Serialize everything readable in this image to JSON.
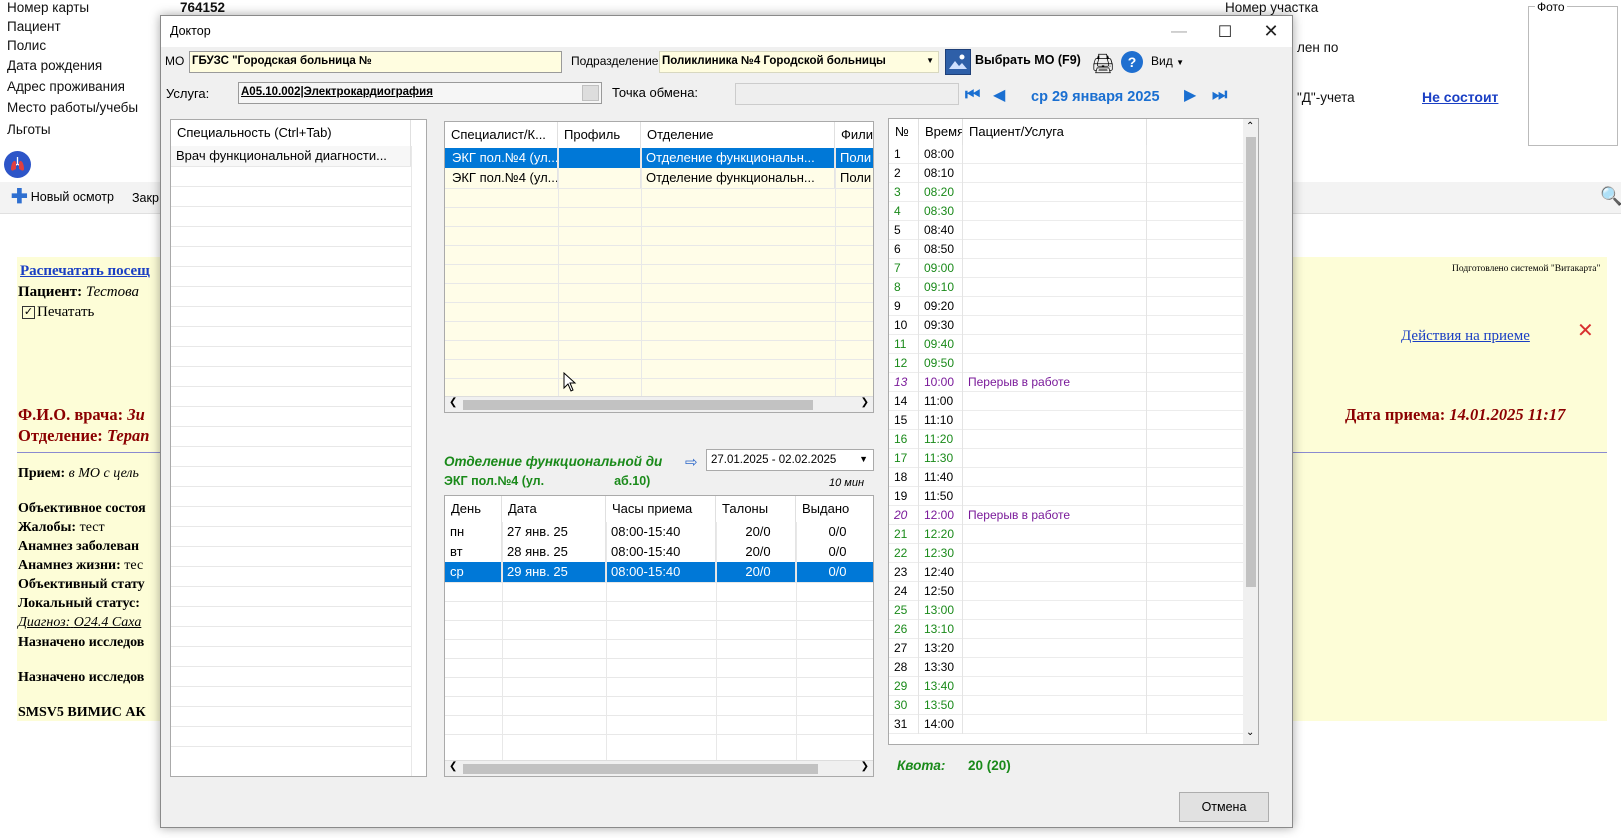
{
  "background": {
    "left_labels": [
      "Номер карты",
      "Пациент",
      "Полис",
      "Дата рождения",
      "Адрес проживания",
      "Место работы/учебы",
      "Льготы"
    ],
    "card_number": "764152",
    "district_label": "Номер участка",
    "photo_label": "Фото",
    "reg_label_fragment": "лен по",
    "d_account_label": "\"Д\"-учета",
    "not_registered_link": "Не состоит",
    "toolbar": {
      "new_exam": "Новый осмотр",
      "close_fragment": "Закр"
    },
    "doc": {
      "print_visit_link": "Распечатать посещ",
      "patient_label": "Пациент:",
      "patient_value": "Тестова",
      "print_checkbox_label": "Печатать",
      "prepared_by": "Подготовлено системой \"Витакарта\"",
      "actions_link": "Действия на приеме",
      "doctor_fio_label": "Ф.И.О. врача:",
      "doctor_fio_value": "Зи",
      "department_label": "Отделение:",
      "department_value": "Терап",
      "visit_date_label": "Дата приема:",
      "visit_date_value": "14.01.2025 11:17",
      "lines": [
        {
          "label": "Прием:",
          "value": "в МО с цель"
        },
        {
          "label": "Объективное состоя",
          "value": ""
        },
        {
          "label": "Жалобы:",
          "value": "тест"
        },
        {
          "label": "Анамнез заболеван",
          "value": ""
        },
        {
          "label": "Анамнез жизни:",
          "value": "тес"
        },
        {
          "label": "Объективный стату",
          "value": ""
        },
        {
          "label": "Локальный статус:",
          "value": ""
        },
        {
          "label": "Диагноз:",
          "value": "O24.4 Саха"
        },
        {
          "label": "Назначено исследов",
          "value": ""
        },
        {
          "label": "Назначено исследов",
          "value": ""
        },
        {
          "label": "SMSV5 ВИМИС АК",
          "value": ""
        }
      ]
    }
  },
  "dialog": {
    "title": "Доктор",
    "mo_label": "МО",
    "mo_value": "ГБУЗС \"Городская больница №",
    "subdivision_label": "Подразделение",
    "subdivision_value": "Поликлиника №4 Городской больницы",
    "select_mo_button": "Выбрать МО (F9)",
    "view_menu": "Вид",
    "service_label": "Услуга:",
    "service_value": "A05.10.002|Электрокардиография",
    "exchange_label": "Точка обмена:",
    "nav_date": "ср 29 января 2025",
    "specialty_grid": {
      "header": "Специальность (Ctrl+Tab)",
      "rows": [
        "Врач функциональной диагности..."
      ]
    },
    "specialist_grid": {
      "headers": [
        "Специалист/К...",
        "Профиль",
        "Отделение",
        "Фили"
      ],
      "rows": [
        [
          "ЭКГ пол.№4 (ул...",
          "",
          "Отделение функциональн...",
          "Поли"
        ],
        [
          "ЭКГ пол.№4 (ул...",
          "",
          "Отделение функциональн...",
          "Поли"
        ]
      ]
    },
    "dept_title": "Отделение функциональной ди",
    "date_range": "27.01.2025 - 02.02.2025",
    "room_title_prefix": "ЭКГ пол.№4 (ул.",
    "room_title_suffix": "аб.10)",
    "duration": "10 мин",
    "schedule_grid": {
      "headers": [
        "День",
        "Дата",
        "Часы приема",
        "Талоны",
        "Выдано"
      ],
      "rows": [
        [
          "пн",
          "27 янв. 25",
          "08:00-15:40",
          "20/0",
          "0/0"
        ],
        [
          "вт",
          "28 янв. 25",
          "08:00-15:40",
          "20/0",
          "0/0"
        ],
        [
          "ср",
          "29 янв. 25",
          "08:00-15:40",
          "20/0",
          "0/0"
        ]
      ]
    },
    "slots_grid": {
      "headers": [
        "№",
        "Время",
        "Пациент/Услуга"
      ],
      "rows": [
        {
          "n": "1",
          "t": "08:00",
          "p": "",
          "c": "black"
        },
        {
          "n": "2",
          "t": "08:10",
          "p": "",
          "c": "black"
        },
        {
          "n": "3",
          "t": "08:20",
          "p": "",
          "c": "green"
        },
        {
          "n": "4",
          "t": "08:30",
          "p": "",
          "c": "green"
        },
        {
          "n": "5",
          "t": "08:40",
          "p": "",
          "c": "black"
        },
        {
          "n": "6",
          "t": "08:50",
          "p": "",
          "c": "black"
        },
        {
          "n": "7",
          "t": "09:00",
          "p": "",
          "c": "green"
        },
        {
          "n": "8",
          "t": "09:10",
          "p": "",
          "c": "green"
        },
        {
          "n": "9",
          "t": "09:20",
          "p": "",
          "c": "black"
        },
        {
          "n": "10",
          "t": "09:30",
          "p": "",
          "c": "black"
        },
        {
          "n": "11",
          "t": "09:40",
          "p": "",
          "c": "green"
        },
        {
          "n": "12",
          "t": "09:50",
          "p": "",
          "c": "green"
        },
        {
          "n": "13",
          "t": "10:00",
          "p": "Перерыв в работе",
          "c": "purple"
        },
        {
          "n": "14",
          "t": "11:00",
          "p": "",
          "c": "black"
        },
        {
          "n": "15",
          "t": "11:10",
          "p": "",
          "c": "black"
        },
        {
          "n": "16",
          "t": "11:20",
          "p": "",
          "c": "green"
        },
        {
          "n": "17",
          "t": "11:30",
          "p": "",
          "c": "green"
        },
        {
          "n": "18",
          "t": "11:40",
          "p": "",
          "c": "black"
        },
        {
          "n": "19",
          "t": "11:50",
          "p": "",
          "c": "black"
        },
        {
          "n": "20",
          "t": "12:00",
          "p": "Перерыв в работе",
          "c": "purple"
        },
        {
          "n": "21",
          "t": "12:20",
          "p": "",
          "c": "green"
        },
        {
          "n": "22",
          "t": "12:30",
          "p": "",
          "c": "green"
        },
        {
          "n": "23",
          "t": "12:40",
          "p": "",
          "c": "black"
        },
        {
          "n": "24",
          "t": "12:50",
          "p": "",
          "c": "black"
        },
        {
          "n": "25",
          "t": "13:00",
          "p": "",
          "c": "green"
        },
        {
          "n": "26",
          "t": "13:10",
          "p": "",
          "c": "green"
        },
        {
          "n": "27",
          "t": "13:20",
          "p": "",
          "c": "black"
        },
        {
          "n": "28",
          "t": "13:30",
          "p": "",
          "c": "black"
        },
        {
          "n": "29",
          "t": "13:40",
          "p": "",
          "c": "green"
        },
        {
          "n": "30",
          "t": "13:50",
          "p": "",
          "c": "green"
        },
        {
          "n": "31",
          "t": "14:00",
          "p": "",
          "c": "black"
        }
      ]
    },
    "quota_label": "Квота:",
    "quota_value": "20 (20)",
    "cancel_button": "Отмена"
  },
  "colors": {
    "selection": "#0078d7",
    "green": "#1a8a1a",
    "purple": "#7a1a9a",
    "nav_blue": "#1a6fd1",
    "doc_bg": "#fdfdd7",
    "grid_bg": "#fffde8"
  }
}
